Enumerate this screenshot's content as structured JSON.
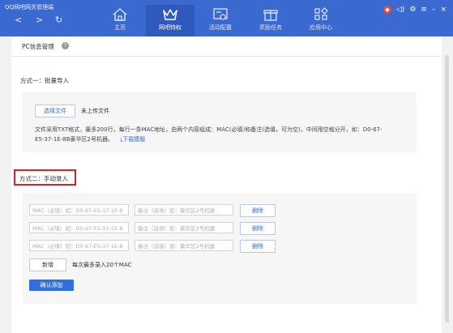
{
  "window": {
    "app_title": "QQ网吧网关管理端",
    "nav_back": "<",
    "nav_forward": ">",
    "nav_refresh": "↻"
  },
  "tabs": [
    {
      "label": "主页",
      "icon": "home-icon",
      "active": false
    },
    {
      "label": "网吧特权",
      "icon": "crown-icon",
      "active": true
    },
    {
      "label": "活动配置",
      "icon": "config-icon",
      "active": false
    },
    {
      "label": "奖励任务",
      "icon": "gift-icon",
      "active": false
    },
    {
      "label": "应用中心",
      "icon": "apps-icon",
      "active": false
    }
  ],
  "top_right": {
    "shield": "◆",
    "volume": "◁)",
    "settings": "⚙",
    "menu": "≡",
    "minimize": "–",
    "close": "×"
  },
  "page": {
    "title": "PC信息管理",
    "help": "?"
  },
  "section1": {
    "title": "方式一：批量导入",
    "choose_file": "选择文件",
    "not_uploaded": "未上传文件",
    "desc_line1": "文件采用TXT格式，最多200行，每行一条MAC地址，由两个内容组成：MAC(必填)和备注(选填，可为空)，中间用空格分开，如：D0-67-",
    "desc_line2": "E5-37-1E-8B豪华区2号机器。",
    "download": "下载模版"
  },
  "section2": {
    "title": "方式二：手动录入",
    "rows": [
      {
        "mac_placeholder": "MAC（必填）如：D0-67-E5-37-1E-8",
        "note_placeholder": "备注（选填）如：豪华区2号机器",
        "delete": "删除"
      },
      {
        "mac_placeholder": "MAC（必填）如：D0-67-E5-37-1E-8",
        "note_placeholder": "备注（选填）如：豪华区2号机器",
        "delete": "删除"
      },
      {
        "mac_placeholder": "MAC（必填）如：D0-67-E5-37-1E-8",
        "note_placeholder": "备注（选填）如：豪华区2号机器",
        "delete": "删除"
      }
    ],
    "add": "新增",
    "max_note": "每次最多录入20个MAC",
    "confirm": "确认添加"
  },
  "colors": {
    "header": "#3a69cf",
    "primary": "#2f6fdf",
    "highlight": "#e02020"
  }
}
